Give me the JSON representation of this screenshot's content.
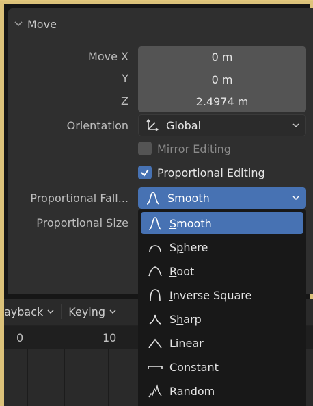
{
  "panel": {
    "title": "Move",
    "move_x": {
      "label": "Move X",
      "value": "0 m"
    },
    "move_y": {
      "label": "Y",
      "value": "0 m"
    },
    "move_z": {
      "label": "Z",
      "value": "2.4974 m"
    },
    "orientation": {
      "label": "Orientation",
      "value": "Global"
    },
    "mirror_editing": {
      "label": "Mirror Editing",
      "checked": false
    },
    "proportional_editing": {
      "label": "Proportional Editing",
      "checked": true
    },
    "proportional_falloff": {
      "label": "Proportional Fall...",
      "value": "Smooth"
    },
    "proportional_size": {
      "label": "Proportional Size"
    }
  },
  "timeline": {
    "playback_label": "ayback",
    "keying_label": "Keying",
    "ruler": [
      "0",
      "10"
    ]
  },
  "falloff_menu": {
    "items": [
      {
        "pre": "",
        "key": "S",
        "post": "mooth",
        "icon": "smooth-curve-icon",
        "selected": true
      },
      {
        "pre": "S",
        "key": "p",
        "post": "here",
        "icon": "sphere-curve-icon"
      },
      {
        "pre": "",
        "key": "R",
        "post": "oot",
        "icon": "root-curve-icon"
      },
      {
        "pre": "",
        "key": "I",
        "post": "nverse Square",
        "icon": "inverse-square-curve-icon"
      },
      {
        "pre": "S",
        "key": "h",
        "post": "arp",
        "icon": "sharp-curve-icon"
      },
      {
        "pre": "",
        "key": "L",
        "post": "inear",
        "icon": "linear-curve-icon"
      },
      {
        "pre": "",
        "key": "C",
        "post": "onstant",
        "icon": "constant-curve-icon"
      },
      {
        "pre": "R",
        "key": "a",
        "post": "ndom",
        "icon": "random-curve-icon"
      }
    ]
  },
  "colors": {
    "accent": "#4772b3",
    "field": "#545454",
    "panel": "#2f2f2f",
    "frame": "#dcc27a"
  }
}
